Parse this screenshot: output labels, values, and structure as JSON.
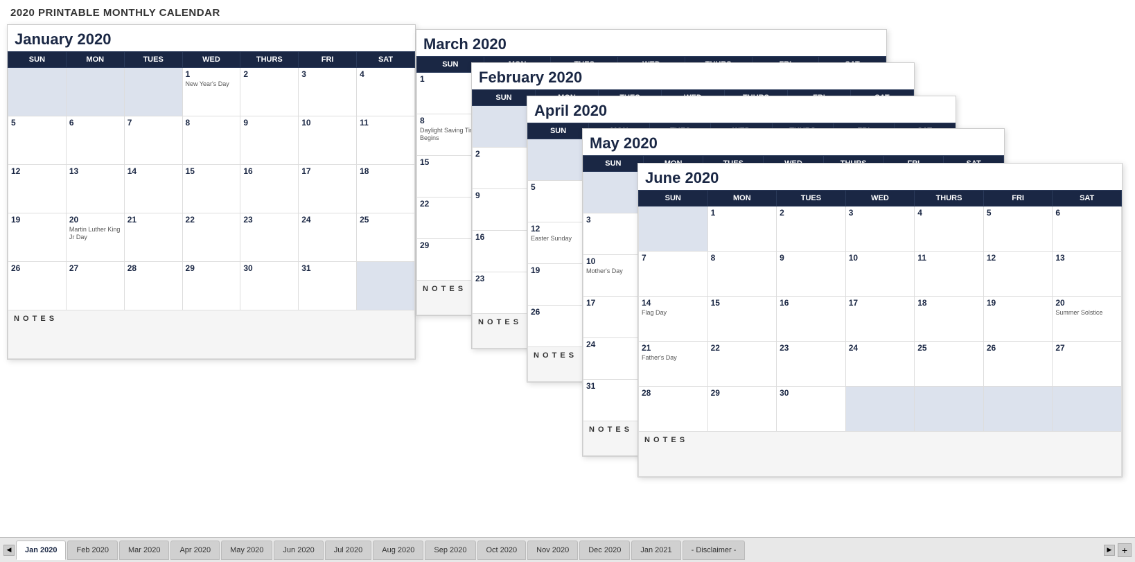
{
  "page": {
    "title": "2020 PRINTABLE MONTHLY CALENDAR"
  },
  "january": {
    "title": "January 2020",
    "headers": [
      "SUN",
      "MON",
      "TUES",
      "WED",
      "THURS",
      "FRI",
      "SAT"
    ],
    "notes_label": "N O T E S",
    "weeks": [
      [
        {
          "day": "",
          "inactive": true
        },
        {
          "day": "",
          "inactive": true
        },
        {
          "day": "",
          "inactive": true
        },
        {
          "day": "1",
          "holiday": "New Year's Day"
        },
        {
          "day": "2",
          "holiday": ""
        },
        {
          "day": "3",
          "holiday": ""
        },
        {
          "day": "4",
          "holiday": ""
        }
      ],
      [
        {
          "day": "5"
        },
        {
          "day": "6"
        },
        {
          "day": "7"
        },
        {
          "day": "8"
        },
        {
          "day": "9"
        },
        {
          "day": "10"
        },
        {
          "day": "11"
        }
      ],
      [
        {
          "day": "12"
        },
        {
          "day": "13"
        },
        {
          "day": "14"
        },
        {
          "day": "15"
        },
        {
          "day": "16"
        },
        {
          "day": "17"
        },
        {
          "day": "18"
        }
      ],
      [
        {
          "day": "19"
        },
        {
          "day": "20",
          "holiday": "Martin Luther King Jr Day"
        },
        {
          "day": "21"
        },
        {
          "day": "22"
        },
        {
          "day": "23"
        },
        {
          "day": "24"
        },
        {
          "day": "25"
        }
      ],
      [
        {
          "day": "26"
        },
        {
          "day": "27"
        },
        {
          "day": "28"
        },
        {
          "day": "29"
        },
        {
          "day": "30"
        },
        {
          "day": "31"
        },
        {
          "day": "",
          "inactive": true
        }
      ]
    ]
  },
  "march": {
    "title": "March 2020",
    "notes_label": "N O T E S"
  },
  "february": {
    "title": "February 2020",
    "notes_label": "N O T E S"
  },
  "april": {
    "title": "April 2020",
    "notes_label": "N O T E S"
  },
  "may": {
    "title": "May 2020",
    "notes_label": "N O T E S"
  },
  "june": {
    "title": "June 2020",
    "headers": [
      "SUN",
      "MON",
      "TUES",
      "WED",
      "THURS",
      "FRI",
      "SAT"
    ],
    "notes_label": "N O T E S",
    "weeks": [
      [
        {
          "day": "",
          "inactive": true
        },
        {
          "day": "1"
        },
        {
          "day": "2"
        },
        {
          "day": "3"
        },
        {
          "day": "4"
        },
        {
          "day": "5"
        },
        {
          "day": "6"
        }
      ],
      [
        {
          "day": "7"
        },
        {
          "day": "8"
        },
        {
          "day": "9"
        },
        {
          "day": "10"
        },
        {
          "day": "11"
        },
        {
          "day": "12"
        },
        {
          "day": "13"
        }
      ],
      [
        {
          "day": "14",
          "holiday": "Flag Day"
        },
        {
          "day": "15"
        },
        {
          "day": "16"
        },
        {
          "day": "17"
        },
        {
          "day": "18"
        },
        {
          "day": "19"
        },
        {
          "day": "20",
          "holiday": "Summer Solstice"
        }
      ],
      [
        {
          "day": "21",
          "holiday": "Father's Day"
        },
        {
          "day": "22"
        },
        {
          "day": "23"
        },
        {
          "day": "24"
        },
        {
          "day": "25"
        },
        {
          "day": "26"
        },
        {
          "day": "27"
        }
      ],
      [
        {
          "day": "28"
        },
        {
          "day": "29"
        },
        {
          "day": "30"
        },
        {
          "day": "",
          "inactive": true
        },
        {
          "day": "",
          "inactive": true
        },
        {
          "day": "",
          "inactive": true
        },
        {
          "day": "",
          "inactive": true
        }
      ]
    ]
  },
  "tabs": [
    {
      "label": "Jan 2020",
      "active": true
    },
    {
      "label": "Feb 2020",
      "active": false
    },
    {
      "label": "Mar 2020",
      "active": false
    },
    {
      "label": "Apr 2020",
      "active": false
    },
    {
      "label": "May 2020",
      "active": false
    },
    {
      "label": "Jun 2020",
      "active": false
    },
    {
      "label": "Jul 2020",
      "active": false
    },
    {
      "label": "Aug 2020",
      "active": false
    },
    {
      "label": "Sep 2020",
      "active": false
    },
    {
      "label": "Oct 2020",
      "active": false
    },
    {
      "label": "Nov 2020",
      "active": false
    },
    {
      "label": "Dec 2020",
      "active": false
    },
    {
      "label": "Jan 2021",
      "active": false
    },
    {
      "label": "- Disclaimer -",
      "active": false
    }
  ]
}
